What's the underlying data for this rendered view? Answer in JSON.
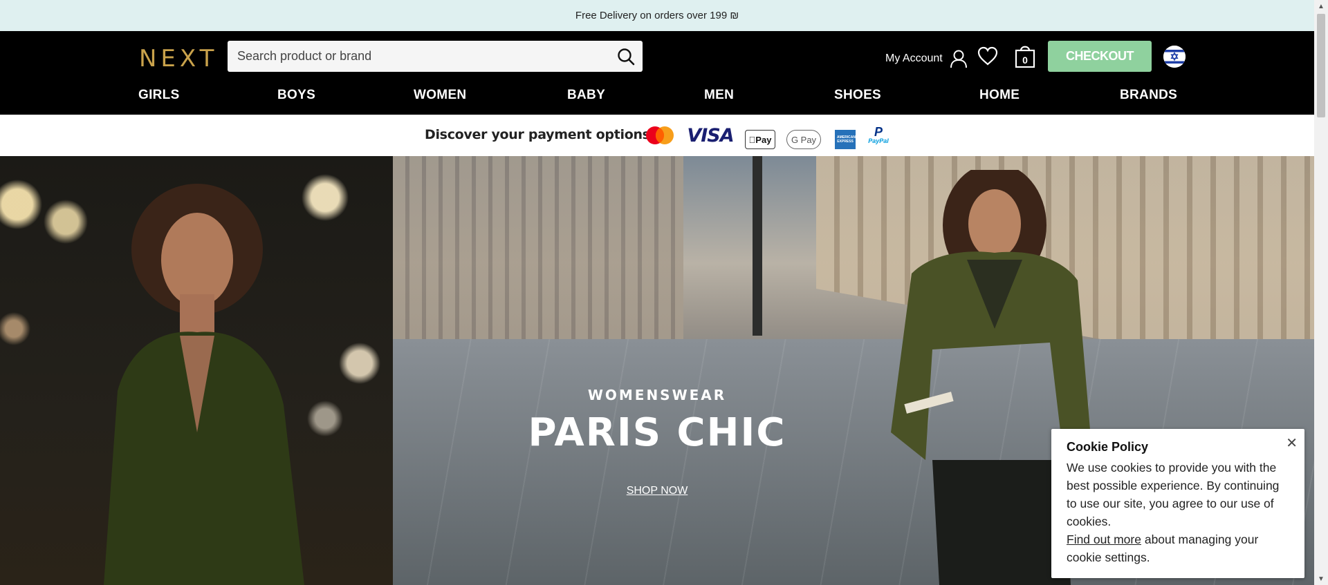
{
  "promo": {
    "text": "Free Delivery on orders over 199 ₪"
  },
  "header": {
    "logo": "NEXT",
    "search_placeholder": "Search product or brand",
    "account_label": "My Account",
    "bag_count": "0",
    "checkout_label": "CHECKOUT"
  },
  "nav": {
    "items": [
      "GIRLS",
      "BOYS",
      "WOMEN",
      "BABY",
      "MEN",
      "SHOES",
      "HOME",
      "BRANDS"
    ]
  },
  "payments": {
    "label": "Discover your payment options",
    "methods": [
      "mastercard-icon",
      "visa-icon",
      "apple-pay-icon",
      "google-pay-icon",
      "amex-icon",
      "paypal-icon"
    ],
    "visa_text": "VISA",
    "applepay_text": "Pay",
    "gpay_text": "G Pay",
    "amex_text": "AMERICAN EXPRESS",
    "paypal_text": "PayPal"
  },
  "hero": {
    "eyebrow": "WOMENSWEAR",
    "headline": "PARIS CHIC",
    "cta": "SHOP NOW"
  },
  "cookie": {
    "title": "Cookie Policy",
    "body": "We use cookies to provide you with the best possible experience. By continuing to use our site, you agree to our use of cookies.",
    "link": "Find out more",
    "tail": "about managing your cookie settings.",
    "close": "✕"
  },
  "colors": {
    "logo": "#c9a24b",
    "checkout": "#8fd19e",
    "promo_bg": "#dff0f0",
    "header_bg": "#000000"
  }
}
